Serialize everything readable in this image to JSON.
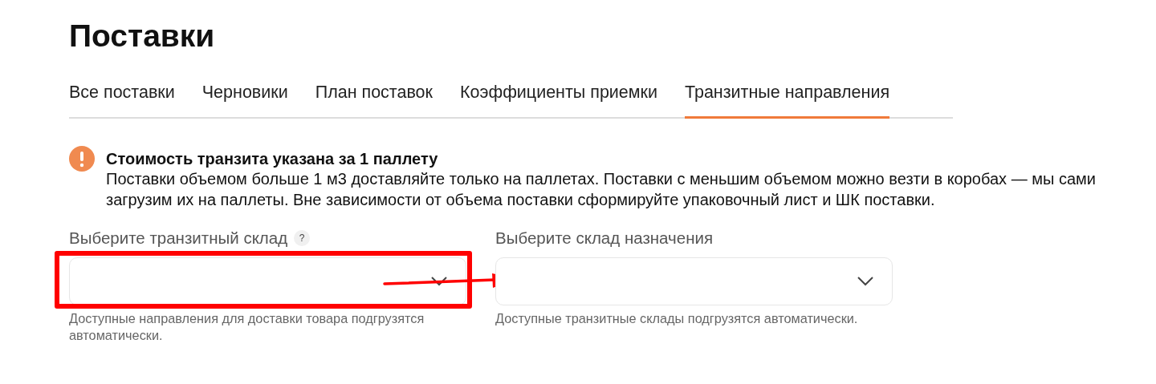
{
  "page_title": "Поставки",
  "tabs": [
    {
      "label": "Все поставки",
      "selected": false
    },
    {
      "label": "Черновики",
      "selected": false
    },
    {
      "label": "План поставок",
      "selected": false
    },
    {
      "label": "Коэффициенты приемки",
      "selected": false
    },
    {
      "label": "Транзитные направления",
      "selected": true
    }
  ],
  "notice": {
    "title": "Стоимость транзита указана за 1 паллету",
    "text": "Поставки объемом больше 1 м3 доставляйте только на паллетах. Поставки с меньшим объемом можно везти в коробах — мы сами загрузим их на паллеты. Вне зависимости от объема поставки сформируйте упаковочный лист и ШК поставки."
  },
  "fields": [
    {
      "label": "Выберите транзитный склад",
      "help_mark": "?",
      "hint": "Доступные направления для доставки товара подгрузятся автоматически.",
      "highlighted": true
    },
    {
      "label": "Выберите склад назначения",
      "hint": "Доступные транзитные склады подгрузятся автоматически.",
      "highlighted": false
    }
  ],
  "annotation_arrow": true
}
